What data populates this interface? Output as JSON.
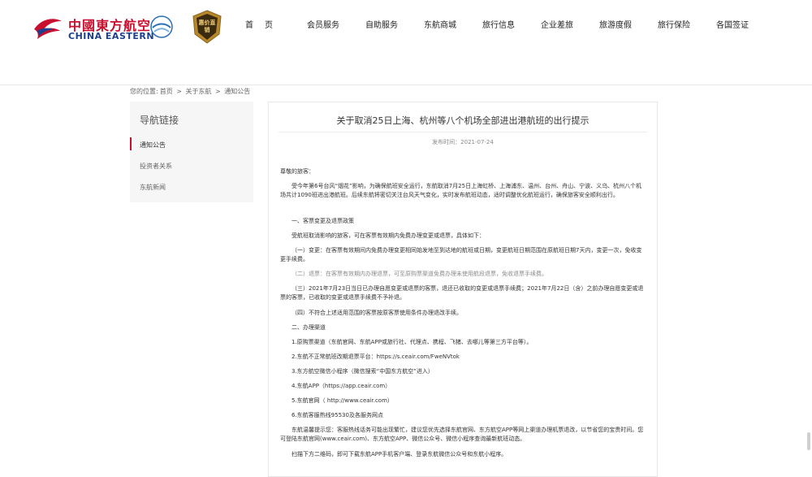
{
  "brand": {
    "cn": "中國東方航空",
    "en": "CHINA EASTERN",
    "badge": "惠价直销"
  },
  "nav": [
    {
      "label": "首页"
    },
    {
      "label": "会员服务"
    },
    {
      "label": "自助服务"
    },
    {
      "label": "东航商城"
    },
    {
      "label": "旅行信息"
    },
    {
      "label": "企业差旅"
    },
    {
      "label": "旅游度假"
    },
    {
      "label": "旅行保险"
    },
    {
      "label": "各国签证"
    }
  ],
  "breadcrumb": {
    "prefix": "您的位置:",
    "items": [
      "首页",
      "关于东航",
      "通知公告"
    ],
    "sep": ">"
  },
  "sidebar": {
    "title": "导航链接",
    "items": [
      {
        "label": "通知公告",
        "active": true
      },
      {
        "label": "投资者关系",
        "active": false
      },
      {
        "label": "东航新闻",
        "active": false
      }
    ]
  },
  "article": {
    "title": "关于取消25日上海、杭州等八个机场全部进出港航班的出行提示",
    "date": "发布时间：2021-07-24",
    "paras": [
      "尊敬的旅客：",
      "受今年第6号台风“烟花”影响，为确保航班安全运行，东航取消7月25日上海虹桥、上海浦东、温州、台州、舟山、宁波、义乌、杭州八个机场共计1090班进出港航班。后续东航将密切关注台风天气变化，实时发布航班动态，适时调整优化航班运行，确保旅客安全顺利出行。",
      "一、客票变更及退票政策",
      "受航班取消影响的旅客，可在客票有效期内免费办理变更或退票，具体如下：",
      "（一）变更：在客票有效期间内免费办理变更相同始发地至到达地的航班或日期，变更航班日期范围在原航班日期7天内，变更一次，免收变更手续费。",
      "（二）退票：在客票有效期内办理退票，可至原购票渠道免费办理未使用航段退票，免收退票手续费。",
      "（三）2021年7月23日当日已办理自愿变更或退票的客票，退还已收取的变更或退票手续费；2021年7月22日（含）之前办理自愿变更或退票的客票，已收取的变更或退票手续费不予补退。",
      "（四）不符合上述适用范围的客票按原客票使用条件办理退改手续。",
      "二、办理渠道",
      "1.原购票渠道（东航官网、东航APP或旅行社、代理点、携程、飞猪、去哪儿等第三方平台等）。",
      "2.东航不正常航班改期退票平台：https://s.ceair.com/FweNVtok",
      "3.东方航空微信小程序（微信搜索“中国东方航空”进入）",
      "4.东航APP（https://app.ceair.com）",
      "5.东航官网（ http://www.ceair.com）",
      "6.东航客服热线95530及各服务网点",
      "东航温馨提示您：客服热线话务可能出现繁忙，建议您优先选择东航官网、东方航空APP等网上渠道办理机票退改，以节省您的宝贵时间。您可登陆东航官网(www.ceair.com)、东方航空APP、微信公众号、微信小程序查询最新航班动态。",
      "扫描下方二维码，即可下载东航APP手机客户端、登录东航微信公众号和东航小程序。"
    ]
  }
}
